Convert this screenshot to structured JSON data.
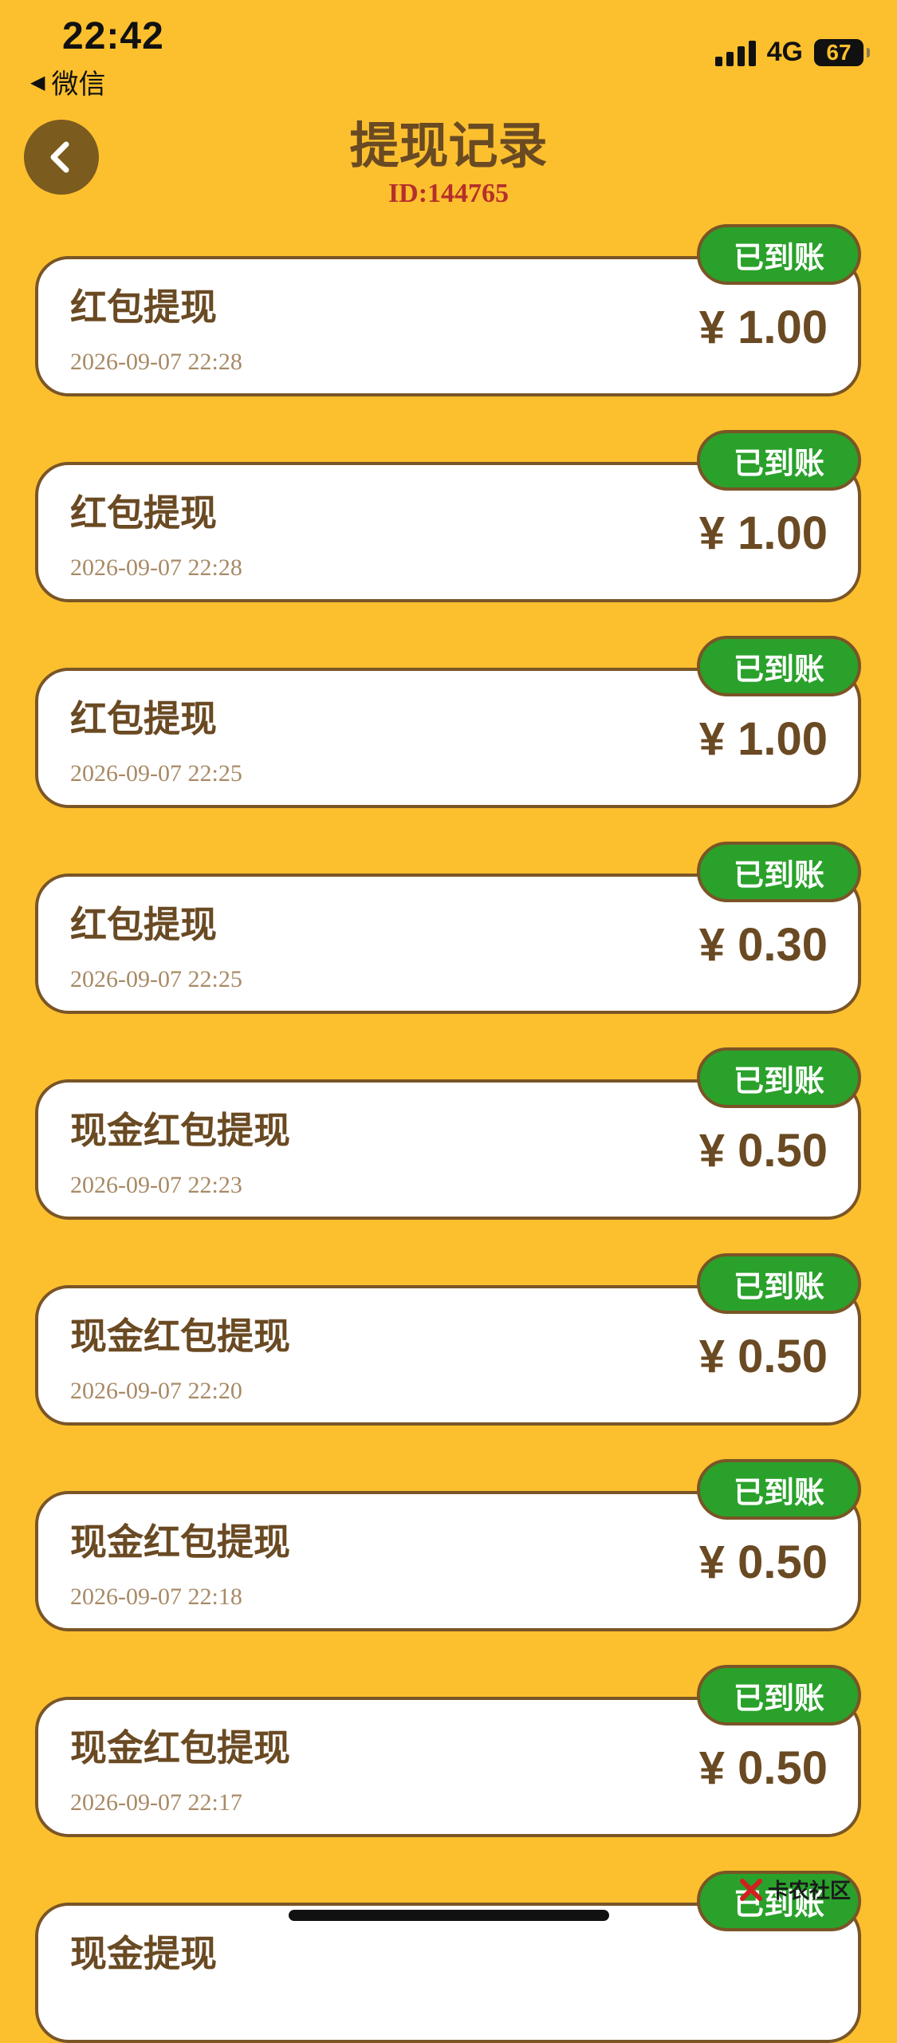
{
  "status_bar": {
    "time": "22:42",
    "back_app": "微信",
    "network": "4G",
    "battery": "67"
  },
  "header": {
    "title": "提现记录",
    "user_id": "ID:144765"
  },
  "records": [
    {
      "title": "红包提现",
      "time": "2026-09-07 22:28",
      "amount": "¥ 1.00",
      "status": "已到账"
    },
    {
      "title": "红包提现",
      "time": "2026-09-07 22:28",
      "amount": "¥ 1.00",
      "status": "已到账"
    },
    {
      "title": "红包提现",
      "time": "2026-09-07 22:25",
      "amount": "¥ 1.00",
      "status": "已到账"
    },
    {
      "title": "红包提现",
      "time": "2026-09-07 22:25",
      "amount": "¥ 0.30",
      "status": "已到账"
    },
    {
      "title": "现金红包提现",
      "time": "2026-09-07 22:23",
      "amount": "¥ 0.50",
      "status": "已到账"
    },
    {
      "title": "现金红包提现",
      "time": "2026-09-07 22:20",
      "amount": "¥ 0.50",
      "status": "已到账"
    },
    {
      "title": "现金红包提现",
      "time": "2026-09-07 22:18",
      "amount": "¥ 0.50",
      "status": "已到账"
    },
    {
      "title": "现金红包提现",
      "time": "2026-09-07 22:17",
      "amount": "¥ 0.50",
      "status": "已到账"
    },
    {
      "title": "现金提现",
      "time": "",
      "amount": "",
      "status": "已到账"
    }
  ],
  "watermark": "卡农社区",
  "colors": {
    "background": "#FCC02E",
    "text_brown": "#6A4A23",
    "id_red": "#B5302A",
    "badge_green": "#2AA12B",
    "border_brown": "#7A5526"
  },
  "icons": {
    "back": "chevron-left-icon"
  }
}
